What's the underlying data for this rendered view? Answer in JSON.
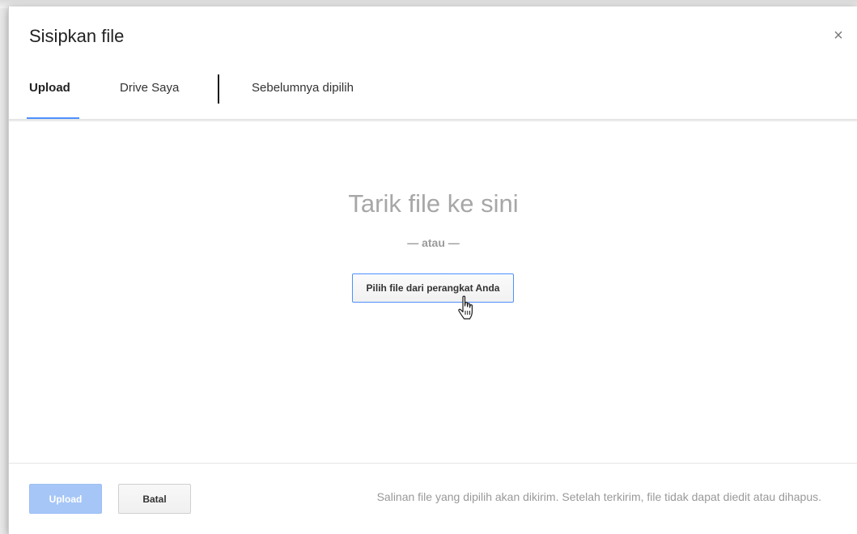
{
  "dialog": {
    "title": "Sisipkan file",
    "close_icon": "close-icon",
    "close_glyph": "×"
  },
  "tabs": [
    {
      "label": "Upload",
      "active": true
    },
    {
      "label": "Drive Saya",
      "active": false
    },
    {
      "label": "Sebelumnya dipilih",
      "active": false
    }
  ],
  "dropzone": {
    "title": "Tarik file ke sini",
    "or_text": "— atau —",
    "pick_button": "Pilih file dari perangkat Anda"
  },
  "footer": {
    "upload_button": "Upload",
    "cancel_button": "Batal",
    "note": "Salinan file yang dipilih akan dikirim. Setelah terkirim, file tidak dapat diedit atau dihapus."
  },
  "colors": {
    "accent": "#4d90fe",
    "upload_disabled": "#a6c6f7"
  }
}
